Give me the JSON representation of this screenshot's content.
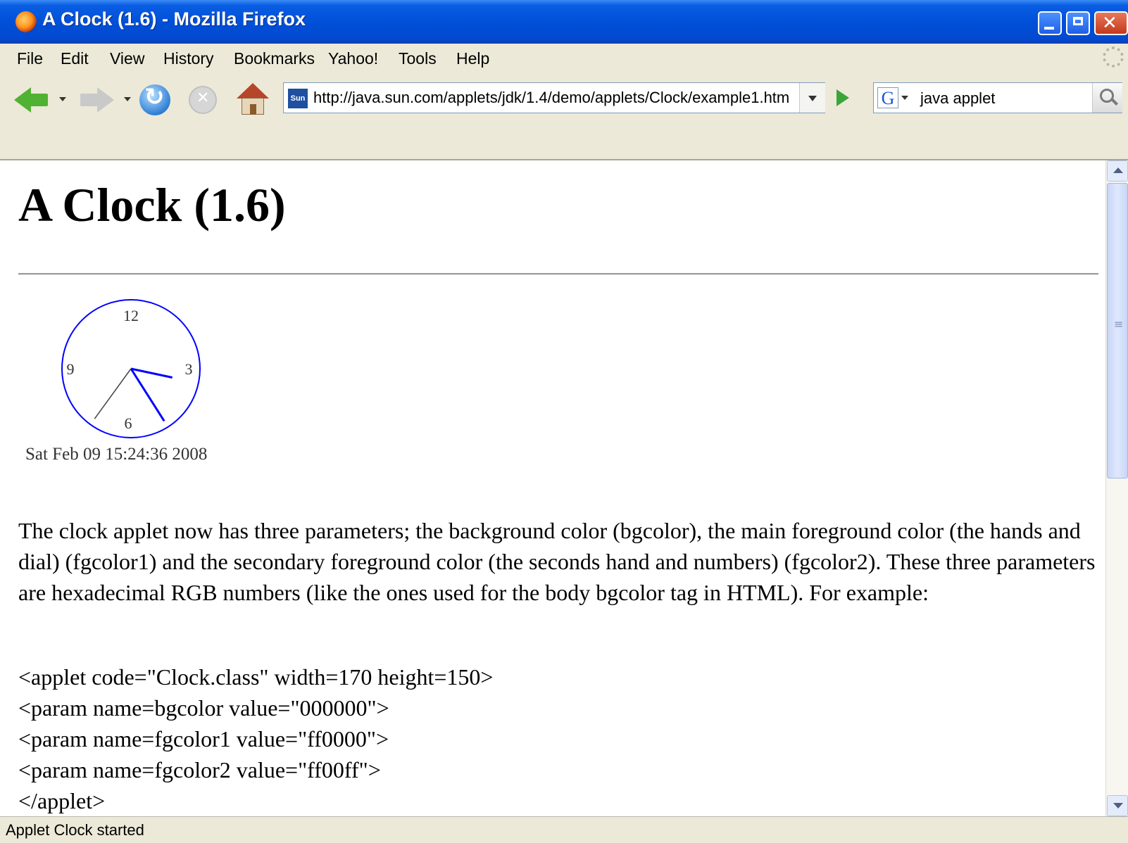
{
  "window": {
    "title": "A Clock (1.6) - Mozilla Firefox"
  },
  "menu": [
    {
      "label": "File"
    },
    {
      "label": "Edit"
    },
    {
      "label": "View"
    },
    {
      "label": "History"
    },
    {
      "label": "Bookmarks"
    },
    {
      "label": "Yahoo!"
    },
    {
      "label": "Tools"
    },
    {
      "label": "Help"
    }
  ],
  "navigation": {
    "url": "http://java.sun.com/applets/jdk/1.4/demo/applets/Clock/example1.htm",
    "site_icon_label": "Sun",
    "search_engine_icon": "G",
    "search_value": "java applet"
  },
  "page": {
    "title": "A Clock (1.6)",
    "clock": {
      "numerals": {
        "twelve": "12",
        "three": "3",
        "six": "6",
        "nine": "9"
      },
      "time": {
        "hours": 15,
        "minutes": 24,
        "seconds": 36
      },
      "date_text": "Sat Feb 09 15:24:36 2008",
      "dial_color": "#0000ff",
      "hands_color": "#0000ff",
      "seconds_hand_color": "#444444"
    },
    "paragraph": "The clock applet now has three parameters; the background color (bgcolor), the main foreground color (the hands and dial) (fgcolor1) and the secondary foreground color (the seconds hand and numbers) (fgcolor2). These three parameters are hexadecimal RGB numbers (like the ones used for the body bgcolor tag in HTML). For example:",
    "code_lines": [
      "<applet code=\"Clock.class\" width=170 height=150>",
      "<param name=bgcolor value=\"000000\">",
      "<param name=fgcolor1 value=\"ff0000\">",
      "<param name=fgcolor2 value=\"ff00ff\">",
      "</applet>"
    ]
  },
  "status": {
    "text": "Applet Clock started"
  }
}
